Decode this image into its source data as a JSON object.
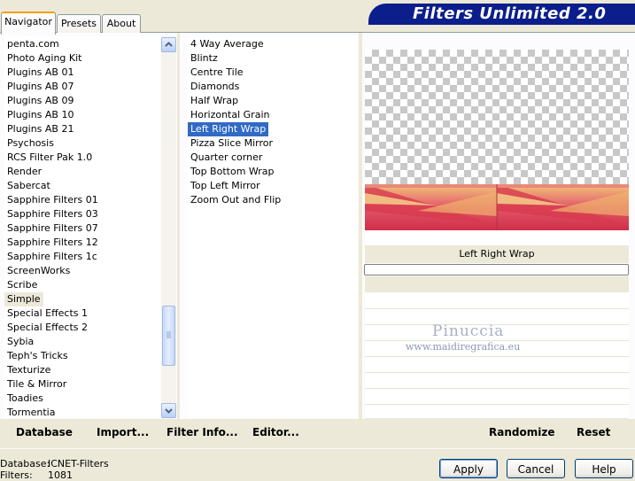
{
  "tabs": [
    "Navigator",
    "Presets",
    "About"
  ],
  "banner": "Filters Unlimited 2.0",
  "categories": [
    "penta.com",
    "Photo Aging Kit",
    "Plugins AB 01",
    "Plugins AB 07",
    "Plugins AB 09",
    "Plugins AB 10",
    "Plugins AB 21",
    "Psychosis",
    "RCS Filter Pak 1.0",
    "Render",
    "Sabercat",
    "Sapphire Filters 01",
    "Sapphire Filters 03",
    "Sapphire Filters 07",
    "Sapphire Filters 12",
    "Sapphire Filters 1c",
    "ScreenWorks",
    "Scribe",
    "Simple",
    "Special Effects 1",
    "Special Effects 2",
    "Sybia",
    "Teph's Tricks",
    "Texturize",
    "Tile & Mirror",
    "Toadies",
    "Tormentia"
  ],
  "selected_category": "Simple",
  "filters": [
    "4 Way Average",
    "Blintz",
    "Centre Tile",
    "Diamonds",
    "Half Wrap",
    "Horizontal Grain",
    "Left Right Wrap",
    "Pizza Slice Mirror",
    "Quarter corner",
    "Top Bottom Wrap",
    "Top Left Mirror",
    "Zoom Out and Flip"
  ],
  "selected_filter": "Left Right Wrap",
  "preview": {
    "filter_name": "Left Right Wrap"
  },
  "watermark": {
    "title": "Pinuccia",
    "url": "www.maidiregrafica.eu"
  },
  "toolbar": {
    "database": "Database",
    "import": "Import...",
    "filter_info": "Filter Info...",
    "editor": "Editor...",
    "randomize": "Randomize",
    "reset": "Reset"
  },
  "status": {
    "database_label": "Database:",
    "database_value": "ICNET-Filters",
    "filters_label": "Filters:",
    "filters_value": "1081"
  },
  "buttons": {
    "apply": "Apply",
    "cancel": "Cancel",
    "help": "Help"
  }
}
